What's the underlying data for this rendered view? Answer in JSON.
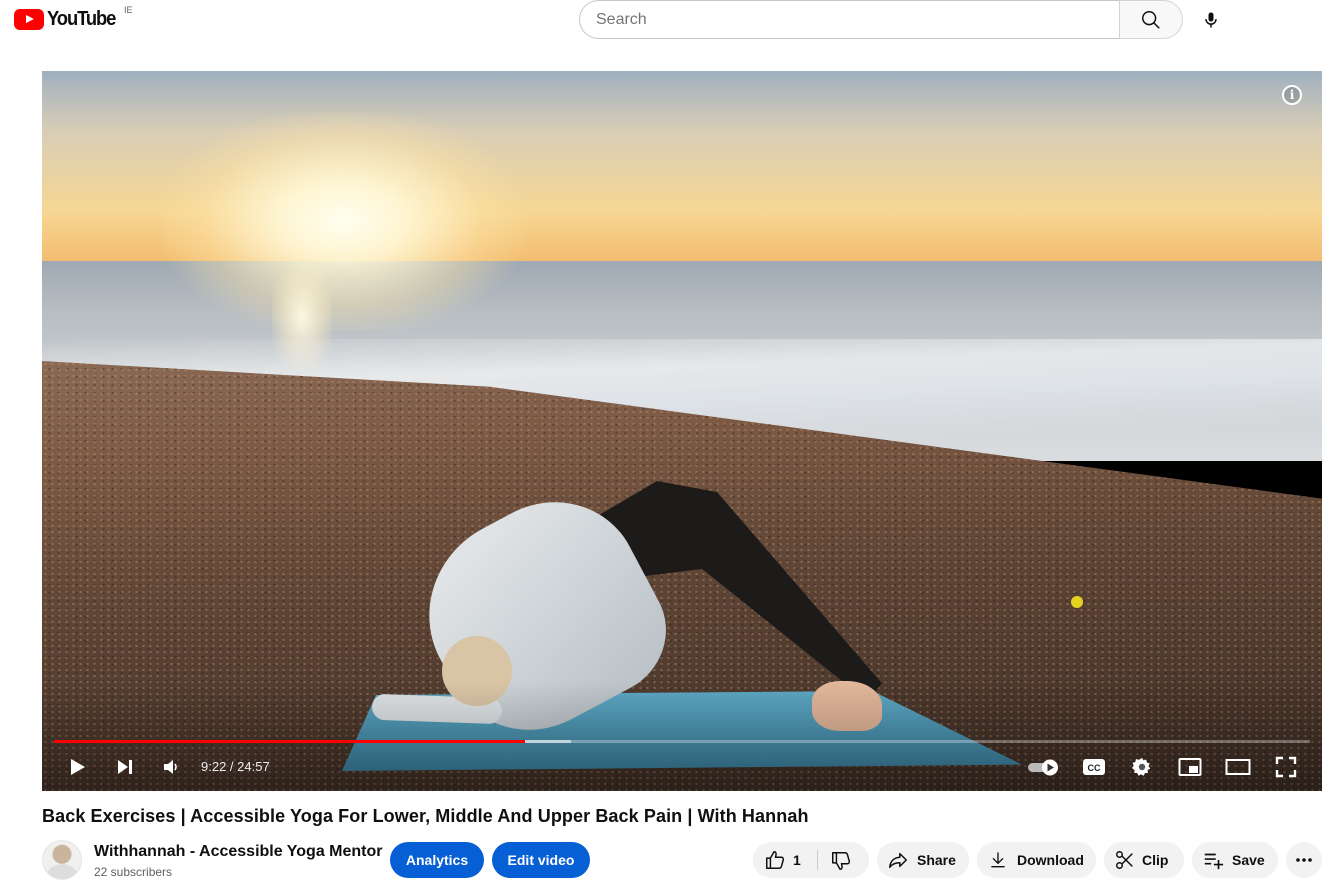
{
  "header": {
    "logo_text": "YouTube",
    "country_code": "IE",
    "search_placeholder": "Search"
  },
  "player": {
    "current_time": "9:22",
    "duration": "24:57",
    "time_display": "9:22 / 24:57",
    "played_fraction": 0.375,
    "buffered_fraction": 0.412,
    "progress_color": "#ff0000"
  },
  "video": {
    "title": "Back Exercises | Accessible Yoga For Lower, Middle And Upper Back Pain | With Hannah"
  },
  "channel": {
    "name": "Withhannah - Accessible Yoga Mentor",
    "subscribers": "22 subscribers"
  },
  "actions": {
    "analytics_label": "Analytics",
    "edit_label": "Edit video",
    "like_count": "1",
    "share_label": "Share",
    "download_label": "Download",
    "clip_label": "Clip",
    "save_label": "Save",
    "accent_color": "#065fd4"
  }
}
